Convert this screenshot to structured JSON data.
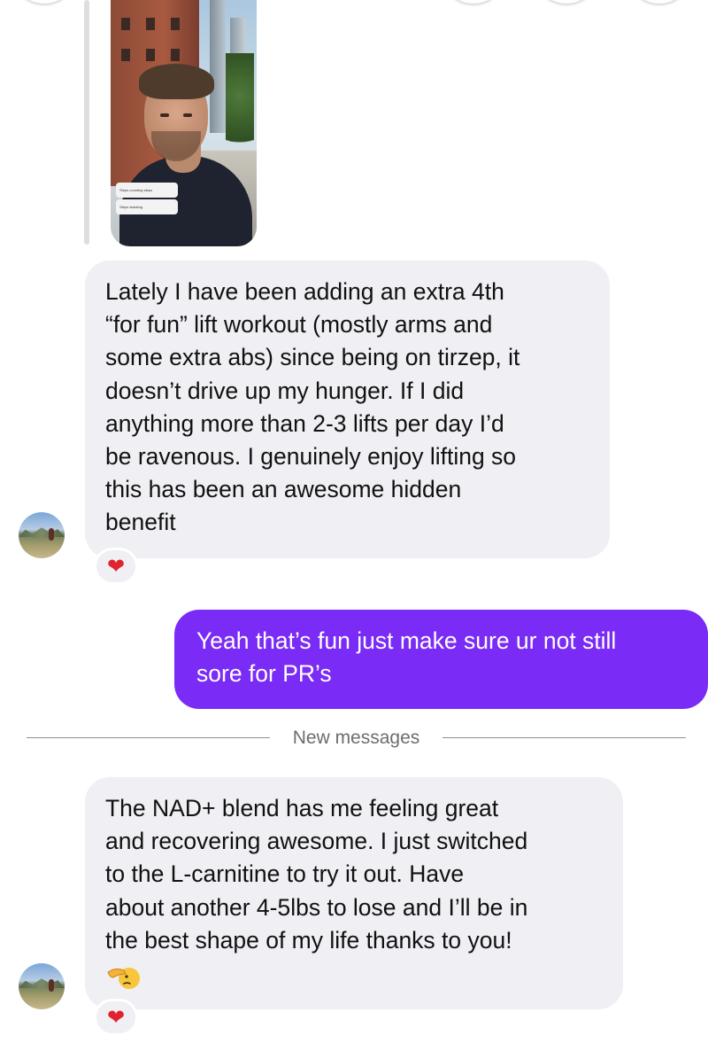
{
  "thread": {
    "story_reply": {
      "poll_options": [
        "Steps counting steps",
        "Steps stacking"
      ]
    },
    "messages": [
      {
        "id": "m1",
        "direction": "incoming",
        "lines": [
          "Lately I have been adding an extra   4th",
          "“for fun” lift workout (mostly arms and",
          "some extra abs) since being on tirzep, it",
          "doesn’t drive up my hunger. If I did",
          "anything more than 2-3 lifts per day I’d",
          "be ravenous. I genuinely enjoy lifting so",
          "this has been an awesome hidden",
          "benefit"
        ],
        "reaction": "❤"
      },
      {
        "id": "m2",
        "direction": "outgoing",
        "lines": [
          "Yeah that’s fun just make sure ur not still",
          "sore for PR’s"
        ]
      },
      {
        "id": "m3",
        "direction": "incoming",
        "lines": [
          "The NAD+ blend has me feeling great",
          "and recovering awesome. I just switched",
          "to the L-carnitine to try it out. Have",
          "about another 4-5lbs to lose and I’ll be in",
          "the best shape of my life thanks to you!"
        ],
        "emoji_icon": "hand-pointing-face-emoji",
        "reaction": "❤"
      }
    ],
    "divider_label": "New messages"
  },
  "colors": {
    "incoming_bubble": "#efeff4",
    "outgoing_bubble": "#7a2bf5",
    "heart": "#e0242f",
    "divider_text": "#6d6d72"
  }
}
